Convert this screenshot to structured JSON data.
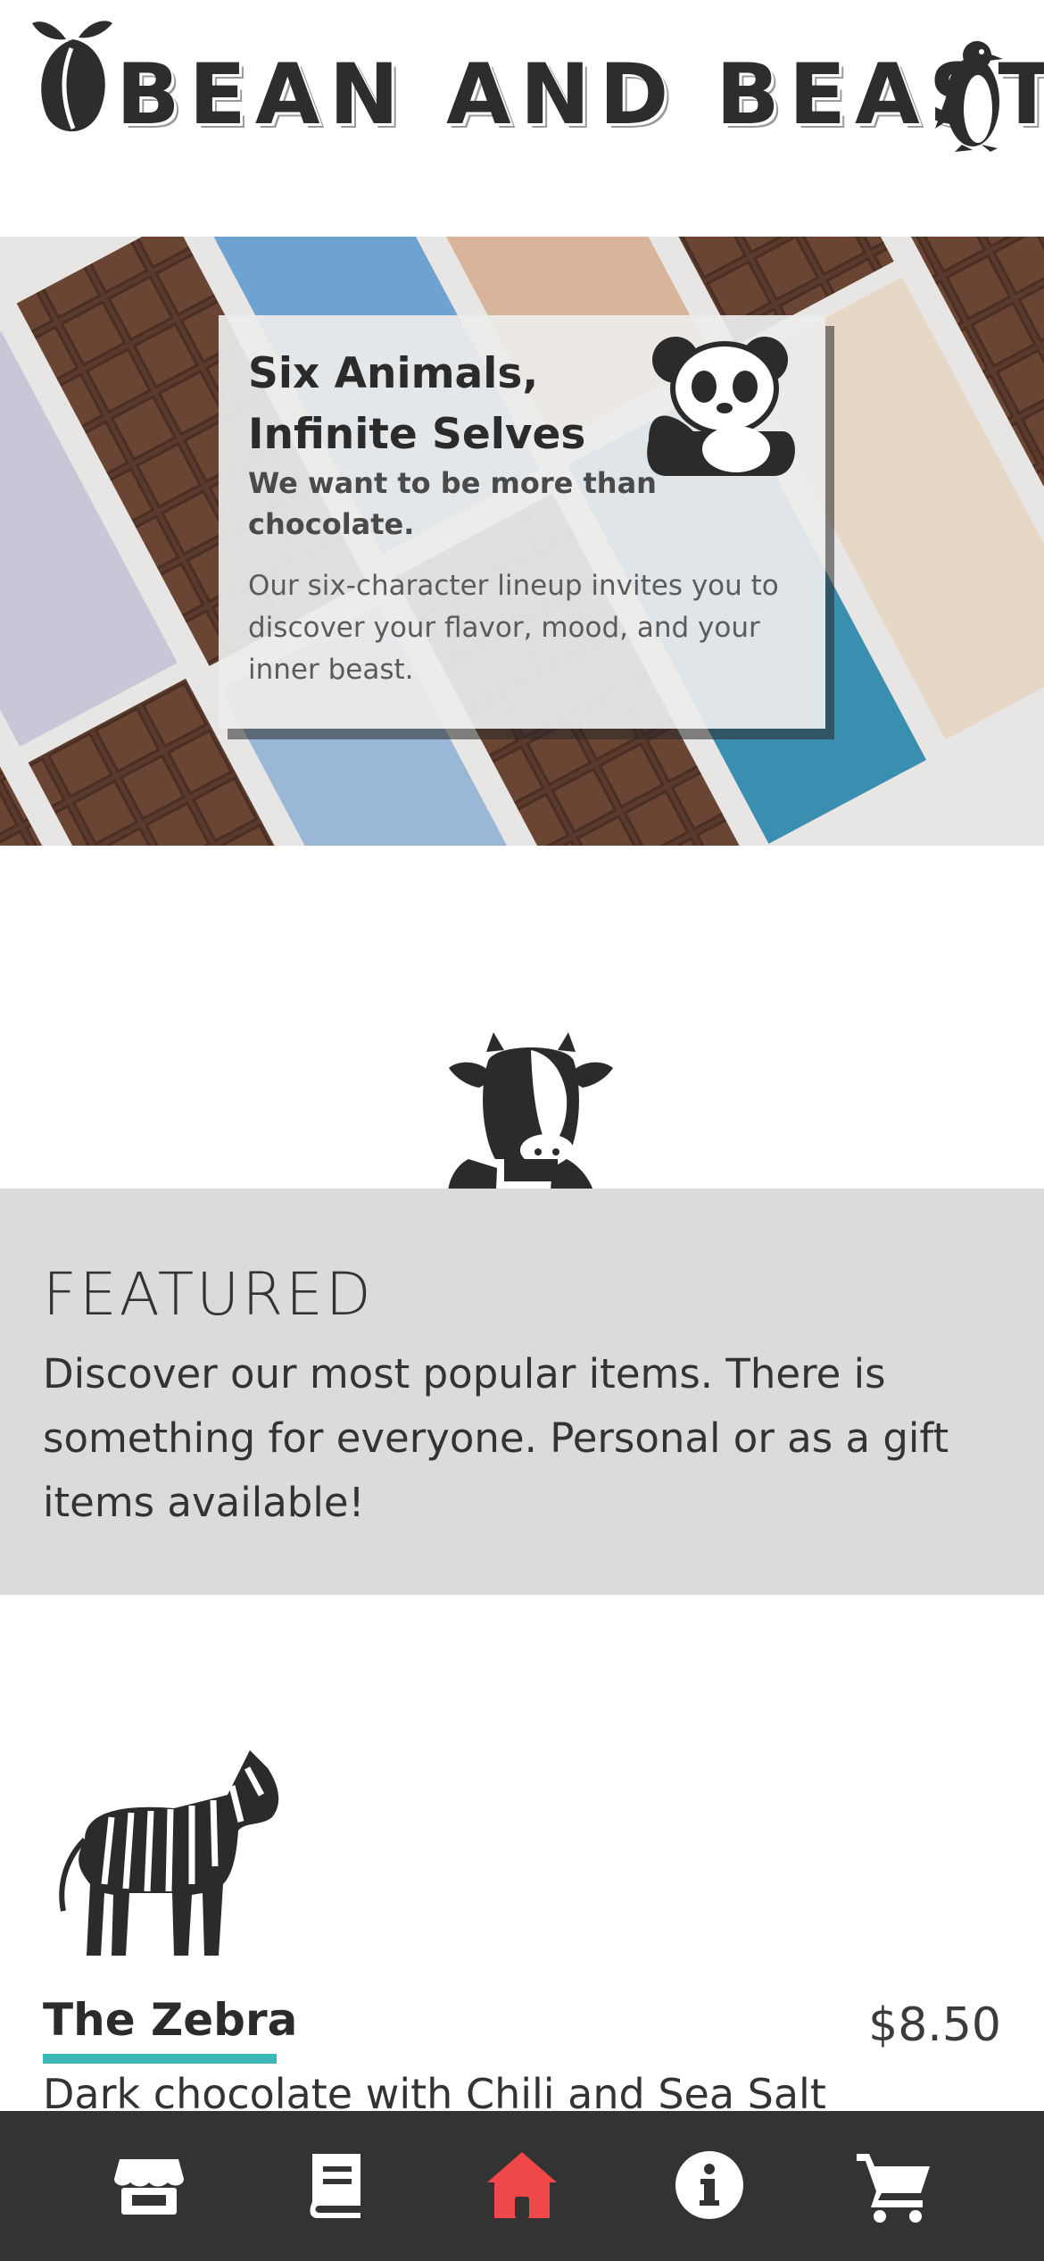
{
  "brand": {
    "name": "BEAN AND BEAST"
  },
  "hero": {
    "title": "Six Animals, Infinite Selves",
    "subtitle": "We want to be more than chocolate.",
    "body": "Our six-character lineup invites you to discover your flavor, mood, and your inner beast."
  },
  "featured": {
    "title": "FEATURED",
    "description": "Discover our most popular items. There is something for everyone. Personal or as a gift items available!"
  },
  "product": {
    "name": "The Zebra",
    "price": "$8.50",
    "description": "Dark chocolate with Chili and Sea Salt"
  },
  "nav": {
    "items": [
      {
        "icon": "store-icon",
        "active": false
      },
      {
        "icon": "menu-book-icon",
        "active": false
      },
      {
        "icon": "home-icon",
        "active": true
      },
      {
        "icon": "info-icon",
        "active": false
      },
      {
        "icon": "cart-icon",
        "active": false
      }
    ]
  },
  "colors": {
    "accent": "#3bb7b8",
    "active_nav": "#f04848",
    "nav_bg": "#333333",
    "featured_bg": "#dbdbdb"
  }
}
